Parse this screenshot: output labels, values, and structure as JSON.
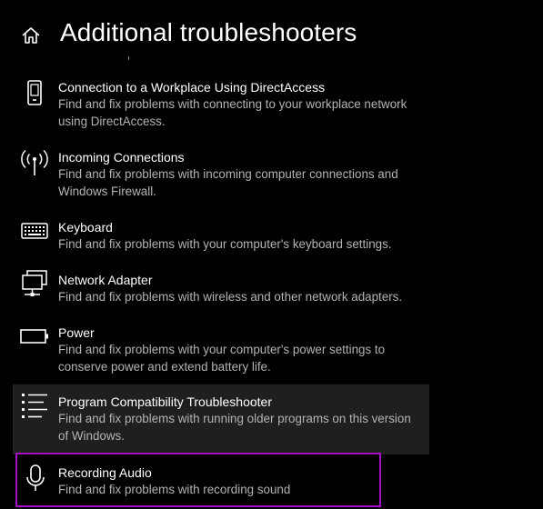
{
  "header": {
    "title": "Additional troubleshooters",
    "home_icon": "home-icon"
  },
  "colors": {
    "background": "#000000",
    "hover_background": "#1f1f1f",
    "description_text": "#b3b3b3",
    "selection_border": "#a113c0"
  },
  "items": [
    {
      "icon": "phone-device-icon",
      "title": "Connection to a Workplace Using DirectAccess",
      "description": "Find and fix problems with connecting to your workplace network using DirectAccess."
    },
    {
      "icon": "antenna-icon",
      "title": "Incoming Connections",
      "description": "Find and fix problems with incoming computer connections and Windows Firewall."
    },
    {
      "icon": "keyboard-icon",
      "title": "Keyboard",
      "description": "Find and fix problems with your computer's keyboard settings."
    },
    {
      "icon": "network-adapter-icon",
      "title": "Network Adapter",
      "description": "Find and fix problems with wireless and other network adapters."
    },
    {
      "icon": "battery-icon",
      "title": "Power",
      "description": "Find and fix problems with your computer's power settings to conserve power and extend battery life."
    },
    {
      "icon": "list-icon",
      "title": "Program Compatibility Troubleshooter",
      "description": "Find and fix problems with running older programs on this version of Windows.",
      "state": "hover"
    },
    {
      "icon": "microphone-icon",
      "title": "Recording Audio",
      "description": "Find and fix problems with recording sound",
      "state": "selected"
    }
  ]
}
